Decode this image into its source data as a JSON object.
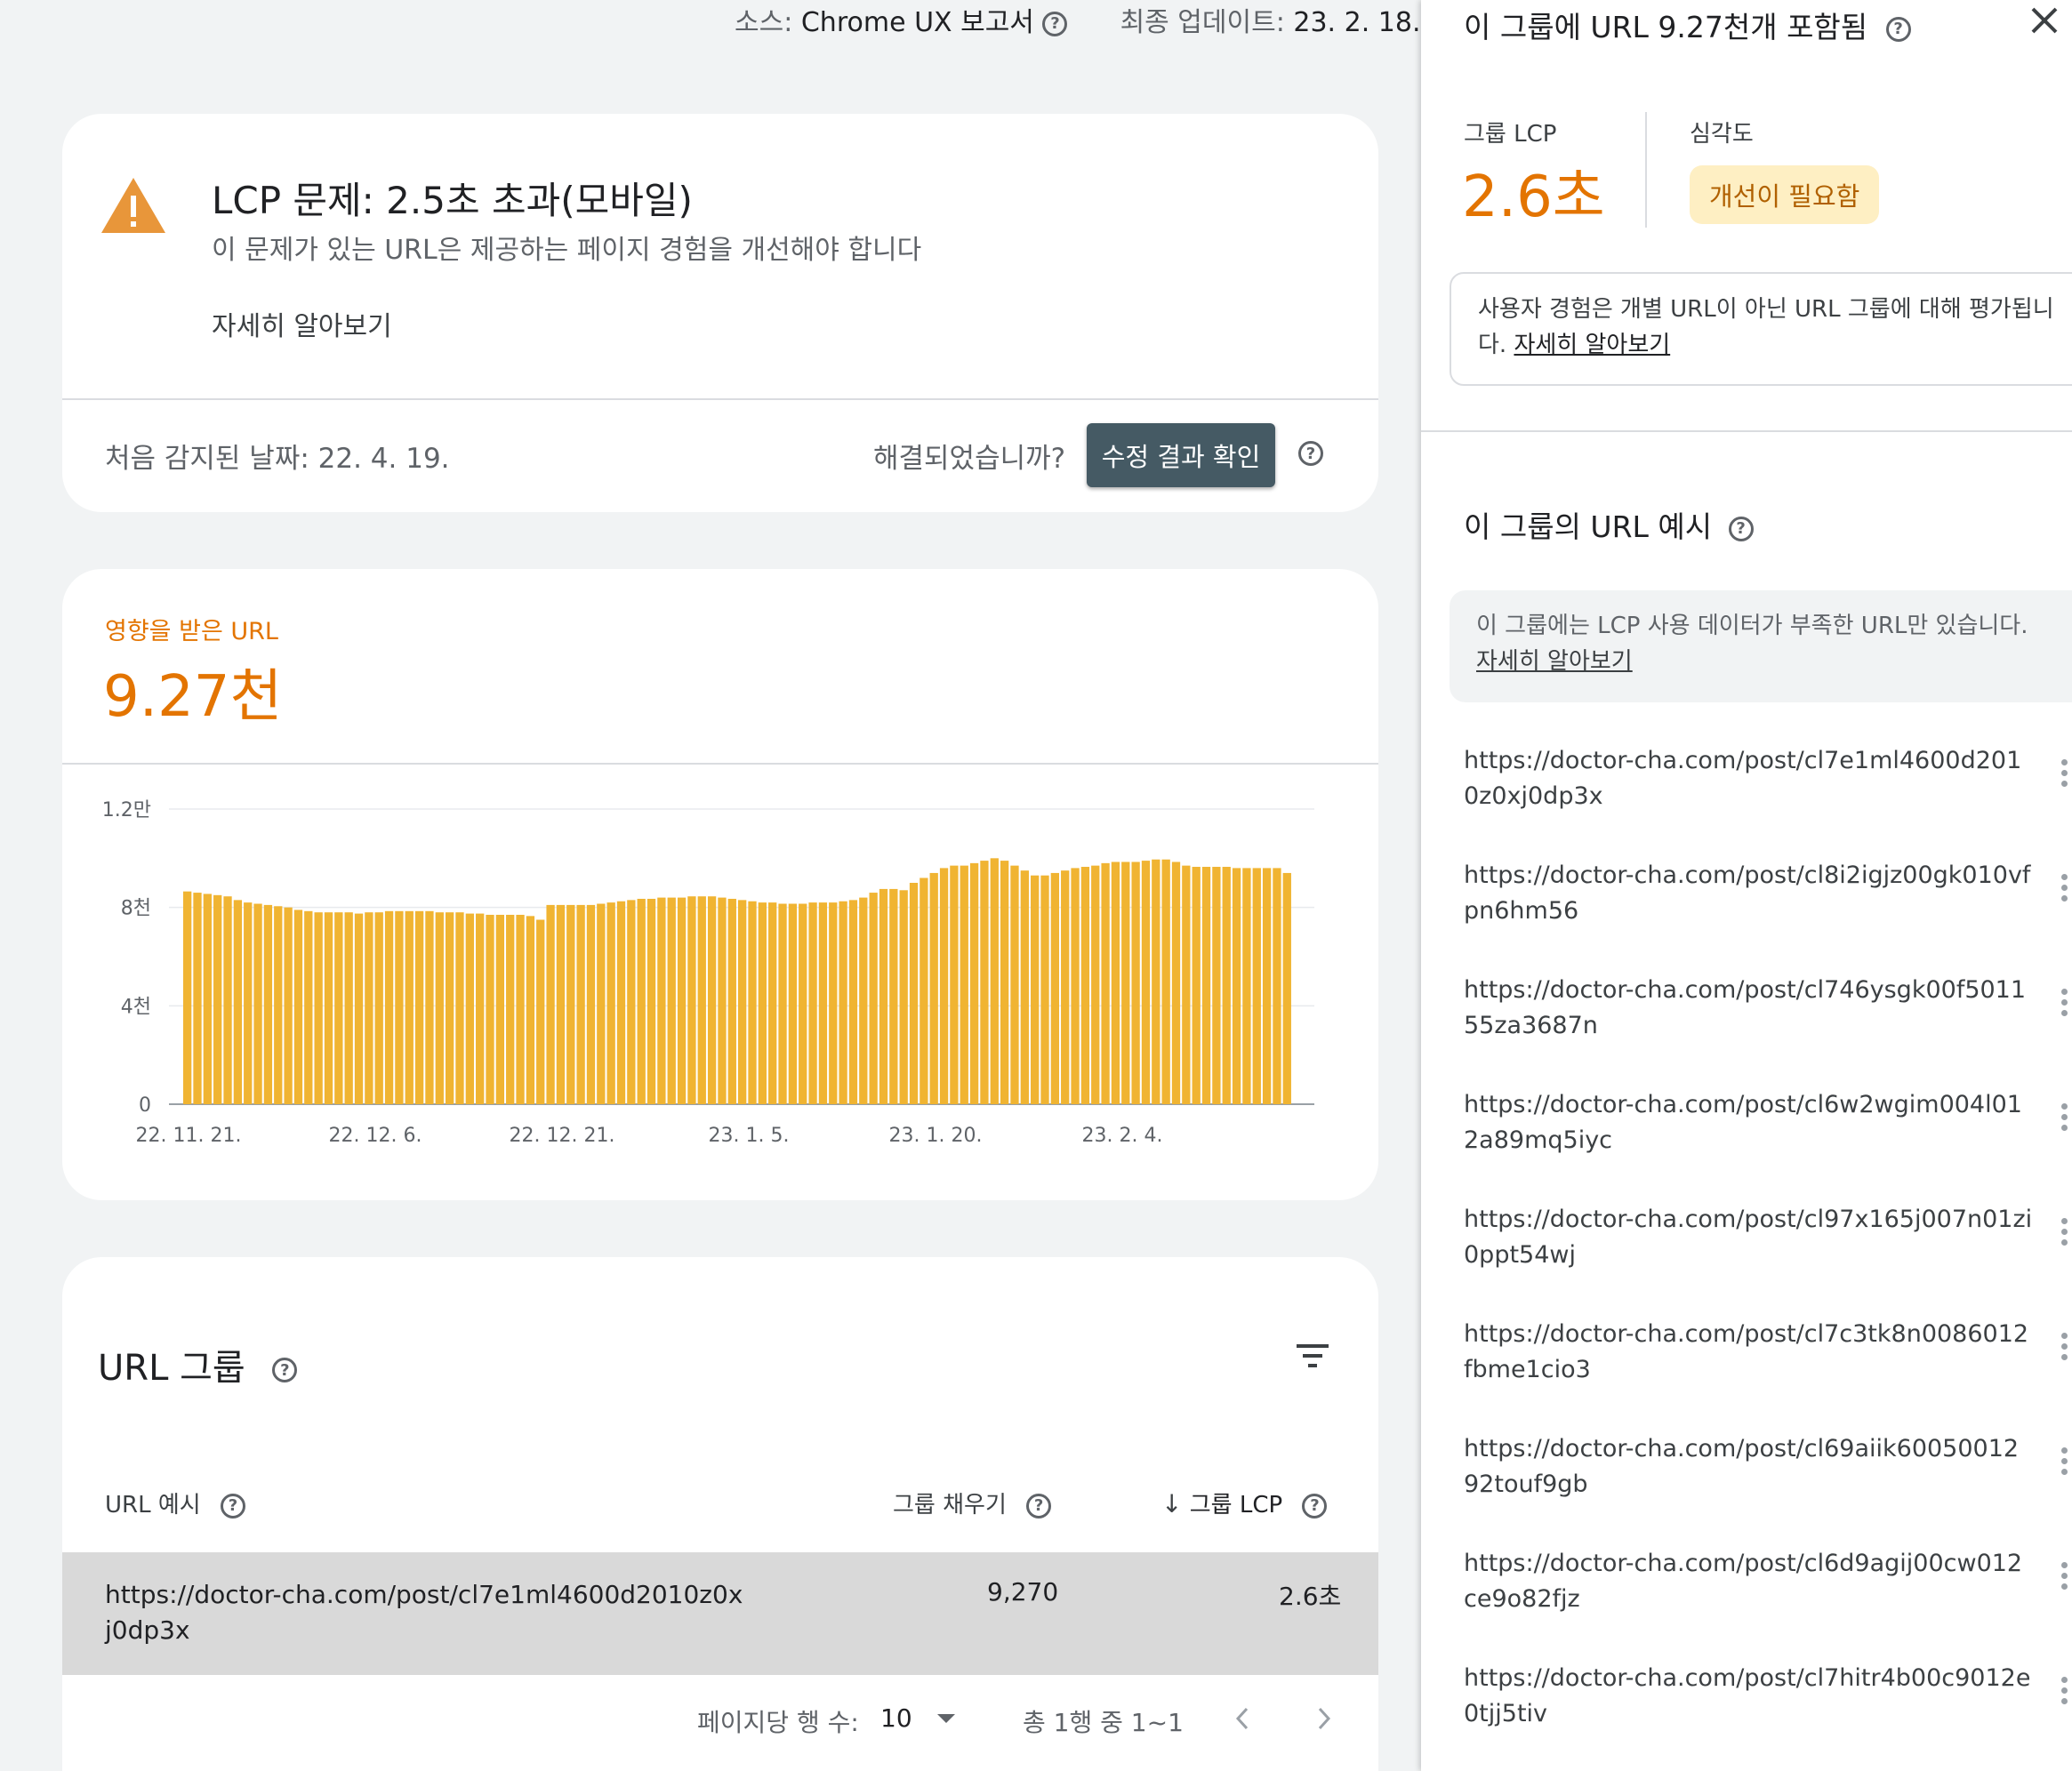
{
  "header": {
    "source_label": "소스:",
    "source_value": "Chrome UX 보고서",
    "updated_label": "최종 업데이트:",
    "updated_value": "23. 2. 18."
  },
  "issue": {
    "title": "LCP 문제: 2.5초 초과(모바일)",
    "subtitle": "이 문제가 있는 URL은 제공하는 페이지 경험을 개선해야 합니다",
    "learn_more": "자세히 알아보기",
    "first_detected": "처음 감지된 날짜: 22. 4. 19.",
    "resolved_question": "해결되었습니까?",
    "validate_button": "수정 결과 확인"
  },
  "affected": {
    "label": "영향을 받은 URL",
    "value": "9.27천"
  },
  "chart_data": {
    "type": "bar",
    "title": "",
    "xlabel": "",
    "ylabel": "",
    "ylim": [
      0,
      12000
    ],
    "yticks": [
      "0",
      "4천",
      "8천",
      "1.2만"
    ],
    "xticks": [
      "22. 11. 21.",
      "22. 12. 6.",
      "22. 12. 21.",
      "23. 1. 5.",
      "23. 1. 20.",
      "23. 2. 4."
    ],
    "color": "#f0b432",
    "values": [
      8650,
      8600,
      8550,
      8500,
      8450,
      8300,
      8200,
      8150,
      8100,
      8050,
      8000,
      7900,
      7850,
      7800,
      7800,
      7800,
      7800,
      7750,
      7800,
      7800,
      7850,
      7850,
      7850,
      7850,
      7850,
      7800,
      7800,
      7800,
      7750,
      7750,
      7700,
      7700,
      7700,
      7700,
      7650,
      7500,
      8100,
      8100,
      8100,
      8100,
      8100,
      8150,
      8200,
      8250,
      8300,
      8350,
      8350,
      8400,
      8400,
      8400,
      8450,
      8450,
      8450,
      8400,
      8350,
      8300,
      8250,
      8200,
      8200,
      8150,
      8150,
      8150,
      8200,
      8200,
      8200,
      8250,
      8300,
      8400,
      8600,
      8750,
      8750,
      8700,
      9000,
      9200,
      9400,
      9600,
      9700,
      9700,
      9800,
      9900,
      10000,
      9900,
      9700,
      9500,
      9300,
      9300,
      9400,
      9500,
      9600,
      9650,
      9700,
      9800,
      9850,
      9850,
      9850,
      9900,
      9950,
      9950,
      9850,
      9700,
      9650,
      9650,
      9650,
      9650,
      9600,
      9600,
      9600,
      9600,
      9600,
      9400
    ]
  },
  "url_groups": {
    "title": "URL 그룹",
    "col_url": "URL 예시",
    "col_fill": "그룹 채우기",
    "col_lcp": "그룹 LCP",
    "rows": [
      {
        "url": "https://doctor-cha.com/post/cl7e1ml4600d2010z0xj0dp3x",
        "fill": "9,270",
        "lcp": "2.6초"
      }
    ],
    "pager": {
      "rows_per_page_label": "페이지당 행 수:",
      "rows_per_page": "10",
      "range": "총 1행 중 1~1"
    }
  },
  "panel": {
    "title": "이 그룹에 URL 9.27천개 포함됨",
    "group_lcp_label": "그룹 LCP",
    "group_lcp_value": "2.6초",
    "severity_label": "심각도",
    "severity_value": "개선이 필요함",
    "info_text": "사용자 경험은 개별 URL이 아닌 URL 그룹에 대해 평가됩니다.",
    "info_link": "자세히 알아보기",
    "examples_title": "이 그룹의 URL 예시",
    "notice_text": "이 그룹에는 LCP 사용 데이터가 부족한 URL만 있습니다.",
    "notice_link": "자세히 알아보기",
    "urls": [
      "https://doctor-cha.com/post/cl7e1ml4600d2010z0xj0dp3x",
      "https://doctor-cha.com/post/cl8i2igjz00gk010vfpn6hm56",
      "https://doctor-cha.com/post/cl746ysgk00f501155za3687n",
      "https://doctor-cha.com/post/cl6w2wgim004l012a89mq5iyc",
      "https://doctor-cha.com/post/cl97x165j007n01zi0ppt54wj",
      "https://doctor-cha.com/post/cl7c3tk8n0086012fbme1cio3",
      "https://doctor-cha.com/post/cl69aiik6005001292touf9gb",
      "https://doctor-cha.com/post/cl6d9agij00cw012ce9o82fjz",
      "https://doctor-cha.com/post/cl7hitr4b00c9012e0tjj5tiv"
    ]
  }
}
